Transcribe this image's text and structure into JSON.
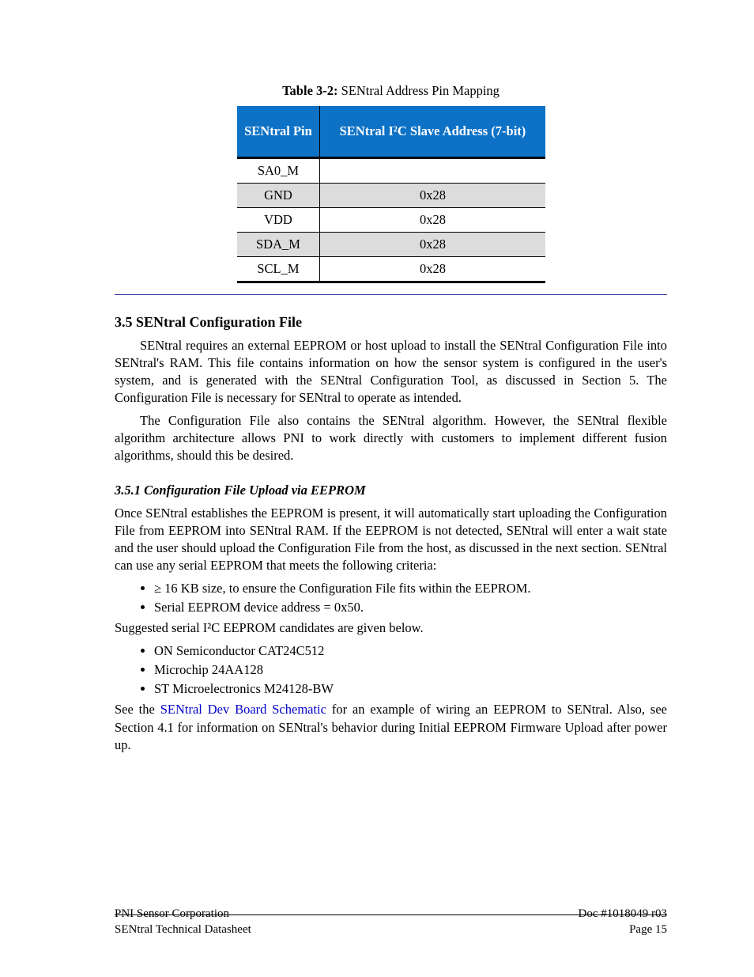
{
  "table": {
    "caption_label": "Table 3-2:",
    "caption_text": "    SENtral Address Pin Mapping",
    "headers": [
      "SENtral Pin",
      "SENtral I²C Slave Address (7-bit)"
    ],
    "rows": [
      {
        "pin": "SA0_M",
        "addr": ""
      },
      {
        "pin": "GND",
        "addr": "0x28",
        "alt": true
      },
      {
        "pin": "VDD",
        "addr": "0x28"
      },
      {
        "pin": "SDA_M",
        "addr": "0x28",
        "alt": true
      },
      {
        "pin": "SCL_M",
        "addr": "0x28",
        "last": true
      }
    ]
  },
  "section35": {
    "heading": "3.5    SENtral Configuration File",
    "para1_firstline": "SENtral requires an external EEPROM or host upload to install the SENtral Configuration File into SENtral's RAM.  This file contains information on how the sensor system is configured in the user's system, and is generated with the SENtral Configuration Tool, as discussed in Section 5.  The Configuration File is necessary for SENtral to operate as intended.",
    "para2": "The Configuration File also contains the SENtral algorithm.  However, the SENtral flexible algorithm architecture allows PNI to work directly with customers to implement different fusion algorithms, should this be desired."
  },
  "section351": {
    "heading": "3.5.1     Configuration File Upload via EEPROM",
    "para1": "Once SENtral establishes the EEPROM is present, it will automatically start uploading the Configuration File from EEPROM into SENtral RAM.  If the EEPROM is not detected, SENtral will enter a wait state and the user should upload the Configuration File from the host, as discussed in the next section.  SENtral can use any serial EEPROM that meets the following criteria:",
    "bullets_a": [
      "≥ 16 KB size, to ensure the Configuration File fits within the EEPROM.",
      "Serial EEPROM device address = 0x50."
    ],
    "para2": "Suggested serial I²C EEPROM candidates are given below.",
    "bullets_b": [
      "ON Semiconductor CAT24C512",
      "Microchip 24AA128",
      "ST Microelectronics M24128-BW"
    ],
    "para3_1": "See the ",
    "para3_link": "SENtral Dev Board Schematic",
    "para3_2": " for an example of wiring an EEPROM to SENtral.  Also, see Section 4.1 for information on SENtral's behavior during Initial EEPROM Firmware Upload after power up."
  },
  "footer": {
    "left": "PNI Sensor Corporation",
    "right": "Doc #1018049 r03",
    "title": "SENtral Technical Datasheet",
    "page": "Page 15"
  }
}
